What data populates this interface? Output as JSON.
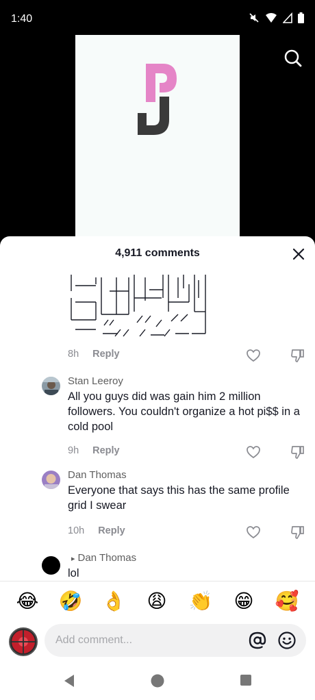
{
  "status_bar": {
    "time": "1:40",
    "icons": [
      "mute-icon",
      "wifi-icon",
      "signal-icon",
      "battery-icon"
    ]
  },
  "video": {
    "logo": "PJ logo",
    "brand_colors": {
      "pink": "#e585c7",
      "dark": "#3a3a3a"
    }
  },
  "comments_sheet": {
    "title": "4,911 comments",
    "close_icon": "close-icon",
    "items": [
      {
        "type": "ascii-art",
        "time": "8h",
        "reply_label": "Reply"
      },
      {
        "username": "Stan Leeroy",
        "text": "All you guys did was gain him 2 million followers. You couldn't organize a hot pi$$ in a cold pool",
        "time": "9h",
        "reply_label": "Reply"
      },
      {
        "username": "Dan Thomas",
        "text": "Everyone that says this has the same profile grid I swear",
        "time": "10h",
        "reply_label": "Reply"
      },
      {
        "username": "Dan Thomas",
        "text": "lol",
        "reply_to_marker": "▸"
      }
    ]
  },
  "emoji_bar": [
    "😂",
    "🤣",
    "👌",
    "😩",
    "👏",
    "😁",
    "🥰"
  ],
  "input": {
    "placeholder": "Add comment...",
    "at_icon": "at-icon",
    "emoji_icon": "smiley-icon"
  },
  "accent_color": "#161823"
}
